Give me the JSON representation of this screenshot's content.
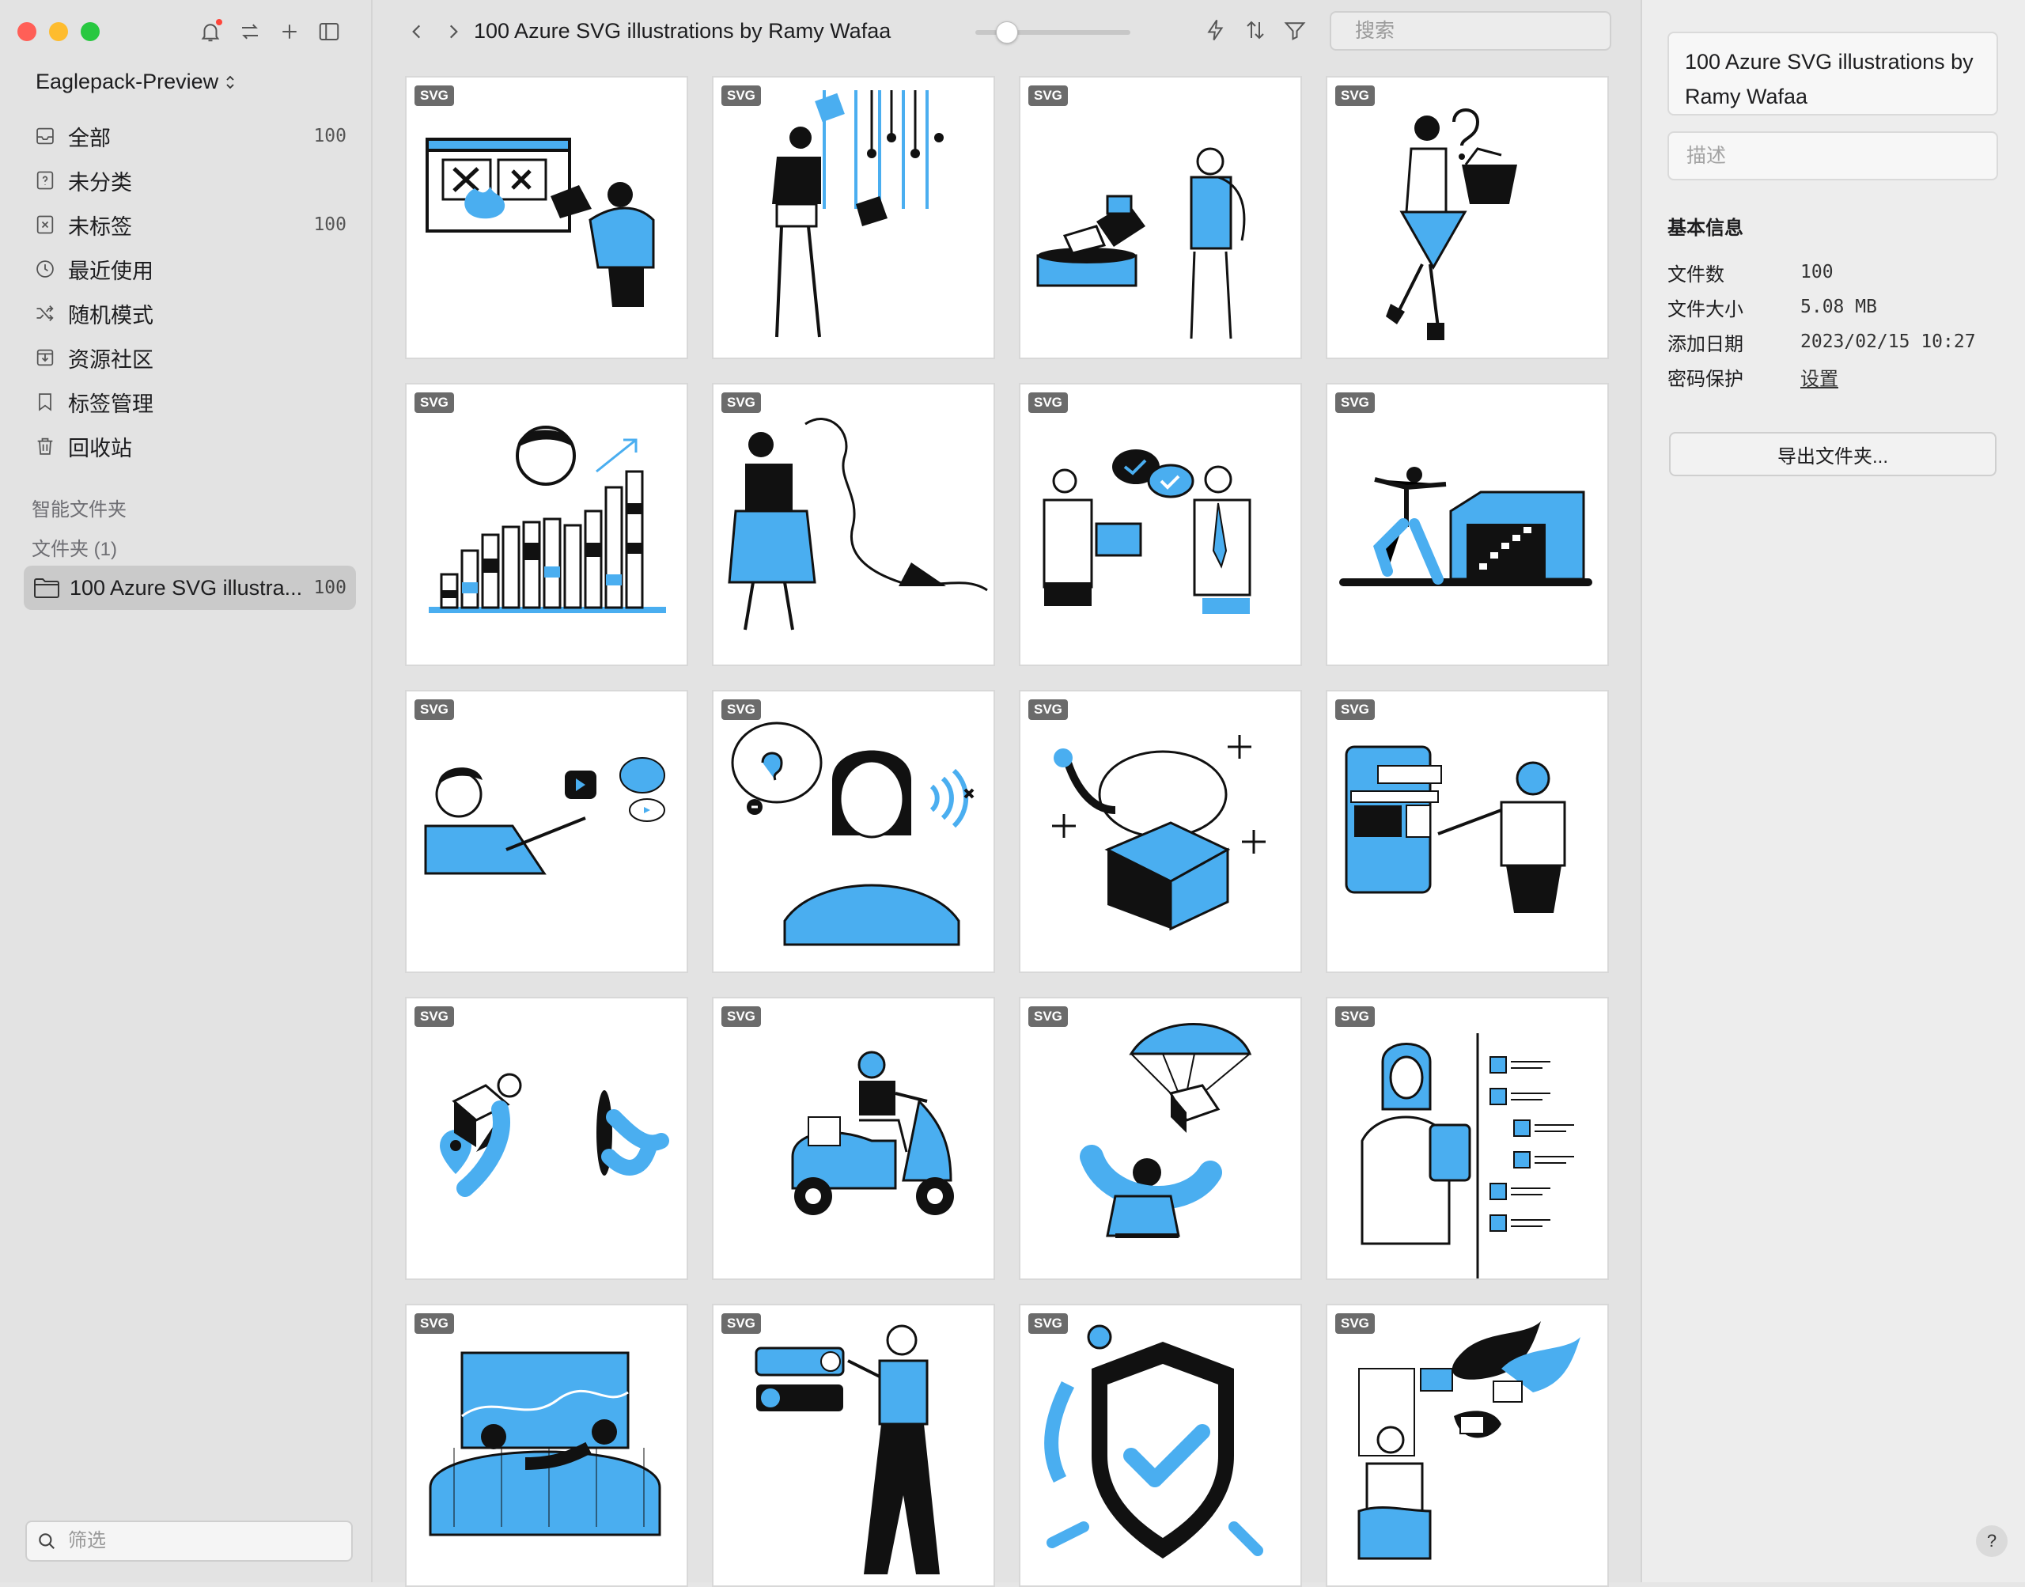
{
  "sidebar": {
    "library_name": "Eaglepack-Preview",
    "nav": [
      {
        "label": "全部",
        "count": "100",
        "icon": "inbox-icon"
      },
      {
        "label": "未分类",
        "count": "",
        "icon": "question-icon"
      },
      {
        "label": "未标签",
        "count": "100",
        "icon": "untagged-icon"
      },
      {
        "label": "最近使用",
        "count": "",
        "icon": "clock-icon"
      },
      {
        "label": "随机模式",
        "count": "",
        "icon": "shuffle-icon"
      },
      {
        "label": "资源社区",
        "count": "",
        "icon": "download-icon"
      },
      {
        "label": "标签管理",
        "count": "",
        "icon": "bookmark-icon"
      },
      {
        "label": "回收站",
        "count": "",
        "icon": "trash-icon"
      }
    ],
    "smart_folders_label": "智能文件夹",
    "folders_label": "文件夹 (1)",
    "folder": {
      "label": "100 Azure SVG illustra...",
      "count": "100"
    },
    "filter_placeholder": "筛选"
  },
  "toolbar": {
    "title": "100 Azure SVG illustrations by Ramy Wafaa",
    "search_placeholder": "搜索"
  },
  "grid": {
    "badge": "SVG",
    "tiles": [
      "browser-fire",
      "man-sliders",
      "man-box",
      "woman-basket",
      "man-chart",
      "woman-scroll",
      "handshake",
      "man-warehouse",
      "man-speech",
      "woman-ear",
      "elephant-box",
      "closed-shop",
      "courier-location",
      "scooter-rider",
      "parachute-box",
      "checklist",
      "couch-tv",
      "toggle-man",
      "shield-check",
      "angry-mails"
    ]
  },
  "inspector": {
    "title": "100 Azure SVG illustrations by Ramy Wafaa",
    "description_placeholder": "描述",
    "section_title": "基本信息",
    "rows": [
      {
        "key": "文件数",
        "value": "100"
      },
      {
        "key": "文件大小",
        "value": "5.08 MB"
      },
      {
        "key": "添加日期",
        "value": "2023/02/15 10:27"
      },
      {
        "key": "密码保护",
        "value": "设置"
      }
    ],
    "export_label": "导出文件夹...",
    "help_label": "?"
  },
  "colors": {
    "accent": "#4aaef0",
    "ink": "#111111",
    "sidebar_bg": "#e3e3e3",
    "selection": "#cacaca"
  }
}
